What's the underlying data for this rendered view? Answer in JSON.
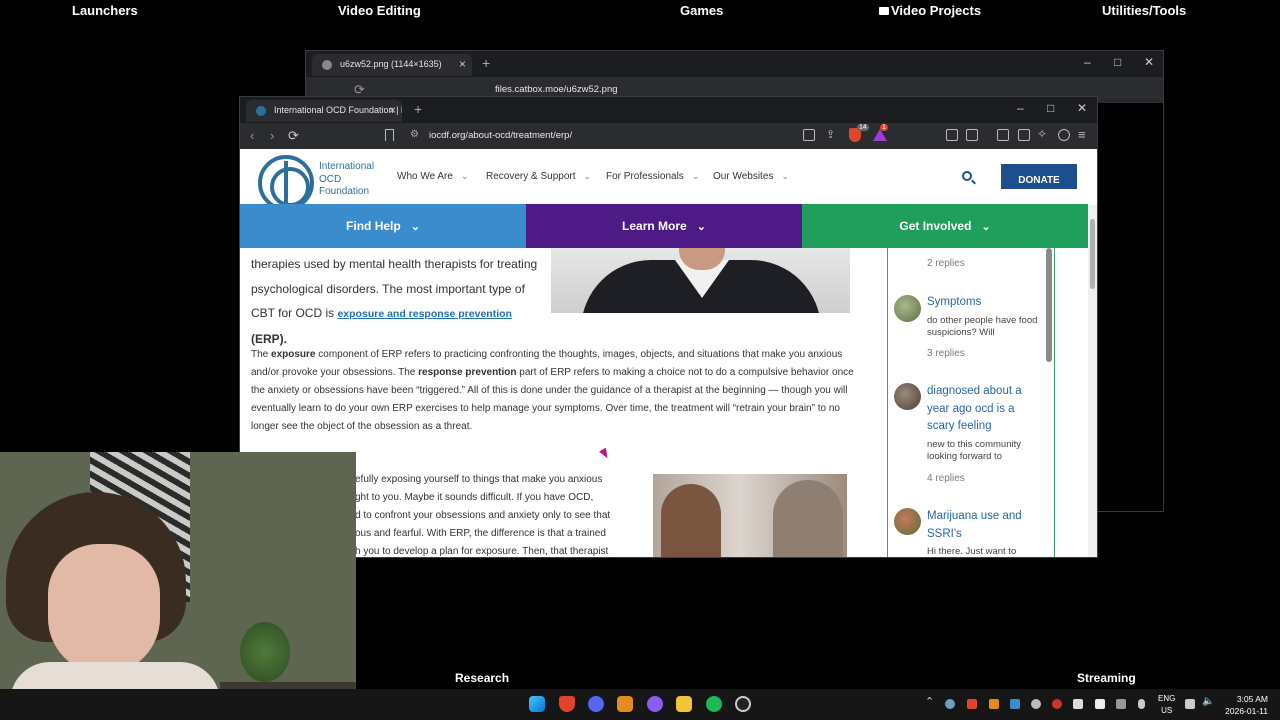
{
  "desktop": {
    "labels": [
      "Launchers",
      "Video Editing",
      "Games",
      "Video Projects",
      "Utilities/Tools"
    ],
    "bottom_labels": [
      "Research",
      "Streaming"
    ]
  },
  "back_browser": {
    "tab_title": "u6zw52.png (1144×1635)",
    "url": "files.catbox.moe/u6zw52.png"
  },
  "browser": {
    "tab_title": "International OCD Foundation | E",
    "url": "iocdf.org/about-ocd/treatment/erp/",
    "shields_count": "14",
    "rewards_count": "1",
    "window_buttons": {
      "minimize": "–",
      "maximize": "□",
      "close": "✕"
    }
  },
  "site": {
    "logo_lines": [
      "International",
      "OCD",
      "Foundation"
    ],
    "nav": [
      "Who We Are",
      "Recovery & Support",
      "For Professionals",
      "Our Websites"
    ],
    "donate": "DONATE",
    "tabs": [
      {
        "label": "Find Help",
        "color": "#3a8ccd"
      },
      {
        "label": "Learn More",
        "color": "#4e1a86"
      },
      {
        "label": "Get Involved",
        "color": "#1f9e5c"
      }
    ]
  },
  "article": {
    "intro_lines": [
      "therapies used by mental health therapists for treating",
      "psychological disorders. The most important type of"
    ],
    "intro_prefix": "CBT for OCD is",
    "intro_link": "exposure and response prevention",
    "intro_suffix": "(ERP).",
    "p2_a": "The",
    "p2_exposure": "exposure",
    "p2_b": "component of ERP refers to practicing confronting the thoughts, images, objects, and situations that make you anxious and/or provoke your obsessions. The",
    "p2_response": "response prevention",
    "p2_c": "part of ERP refers to making a choice not to do a compulsive behavior once the anxiety or obsessions have been “triggered.” All of this is done under the guidance of a therapist at the beginning — though you will eventually learn to do your own ERP exercises to help manage your symptoms. Over time, the treatment will “retrain your brain” to no longer see the object of the obsession as a threat.",
    "p3_lines": [
      "efully exposing yourself to things that make you anxious",
      "ght to you. Maybe it sounds difficult. If you have OCD,",
      "d to confront your obsessions and anxiety only to see that",
      "ous and fearful. With ERP, the difference is that a trained",
      "h you to develop a plan for exposure. Then, that therapist"
    ]
  },
  "sidebar": {
    "top_reply": "2 replies",
    "posts": [
      {
        "title": "Symptoms",
        "snippet": "do other people have food suspicions? Will",
        "replies": "3 replies"
      },
      {
        "title": "diagnosed about a year ago ocd is a scary feeling",
        "snippet": "new to this community looking forward to",
        "replies": "4 replies"
      },
      {
        "title": "Marijuana use and SSRI's",
        "snippet": "Hi there. Just want to"
      }
    ]
  },
  "taskbar": {
    "lang": "ENG",
    "region": "US",
    "time": "3:05 AM",
    "date": "2026-01-11"
  }
}
